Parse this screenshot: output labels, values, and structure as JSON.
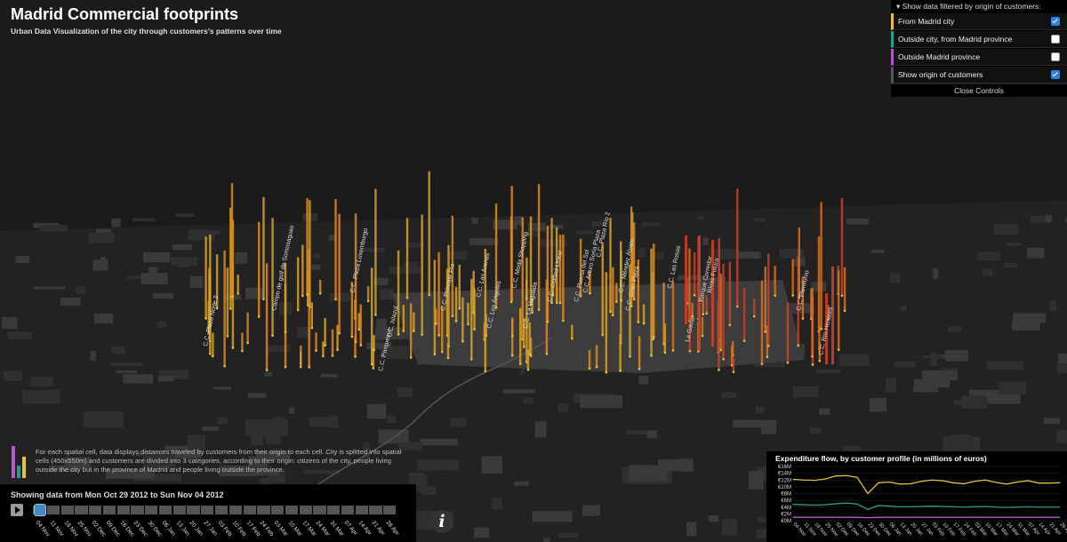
{
  "header": {
    "title": "Madrid Commercial footprints",
    "subtitle": "Urban Data Visualization of the city through customers's patterns over time"
  },
  "controls": {
    "heading": "Show data filtered by origin of customers:",
    "rows": [
      {
        "label": "From Madrid city",
        "checked": true,
        "color": "#e5c23a"
      },
      {
        "label": "Outside city, from Madrid province",
        "checked": false,
        "color": "#2a9a8d"
      },
      {
        "label": "Outside Madrid province",
        "checked": false,
        "color": "#b35bc4"
      },
      {
        "label": "Show origin of customers",
        "checked": true,
        "color": "#555555"
      }
    ],
    "close_label": "Close Controls"
  },
  "description": "For each spatial cell, data displays distances traveled by customers from their origin to each cell. City is splitted into spatial cells (450x550m) and customers are divided into 3 categories, according to their origin: citizens of the city, people living outside the city but in the province of Madrid and people living outside the province.",
  "timeline": {
    "showing": "Showing data from Mon Oct 29 2012 to Sun Nov 04 2012",
    "progress": 0.0,
    "weeks": [
      "04 Nov",
      "11 Nov",
      "18 Nov",
      "25 Nov",
      "02 Dec",
      "09 Dec",
      "16 Dec",
      "23 Dec",
      "30 Dec",
      "06 Jan",
      "13 Jan",
      "20 Jan",
      "27 Jan",
      "03 Feb",
      "10 Feb",
      "17 Feb",
      "24 Feb",
      "03 Mar",
      "10 Mar",
      "17 Mar",
      "24 Mar",
      "31 Mar",
      "07 Apr",
      "14 Apr",
      "21 Apr",
      "28 Apr"
    ]
  },
  "map_labels": [
    "C.C. Plaza Norte 2",
    "Campo de golf de Somosaguas",
    "C.C. Plaza Luxemburgo",
    "C.C. Parquesur",
    "C.C. Islazul",
    "C.C. Príncipe Pío",
    "C.C. Las Arenas",
    "C.C. Los Ángeles",
    "C.C. Moda Shopping",
    "C.C. La Vaguada",
    "C.C. Ciudad Lineal",
    "C.C. Puerta del Sol",
    "C.C. Arturo Soria Plaza",
    "C.C. Plaza Río 2",
    "C.C. Méndez Álvaro",
    "C.C. Gran Plaza",
    "C.C. Las Rosas",
    "La Gavia",
    "Parque Corredor",
    "Rivas Futura",
    "C.C. Plenilunio",
    "C.C. Río Henares"
  ],
  "chart_data": {
    "type": "line",
    "title": "Expenditure flow, by customer profile (in millions of euros)",
    "x": [
      "04 Nov",
      "11 Nov",
      "18 Nov",
      "25 Nov",
      "02 Dec",
      "09 Dec",
      "16 Dec",
      "23 Dec",
      "30 Dec",
      "06 Jan",
      "13 Jan",
      "20 Jan",
      "27 Jan",
      "03 Feb",
      "10 Feb",
      "17 Feb",
      "24 Feb",
      "03 Mar",
      "10 Mar",
      "17 Mar",
      "24 Mar",
      "31 Mar",
      "07 Apr",
      "14 Apr",
      "21 Apr",
      "28 Apr"
    ],
    "series": [
      {
        "color": "#e5c23a",
        "values": [
          12.2,
          12.0,
          11.9,
          12.3,
          13.2,
          13.3,
          12.8,
          8.0,
          11.2,
          11.4,
          10.8,
          10.9,
          11.6,
          12.0,
          11.8,
          11.2,
          10.9,
          11.6,
          12.0,
          11.3,
          10.8,
          11.4,
          11.8,
          11.1,
          11.1,
          11.2
        ]
      },
      {
        "color": "#2a9a8d",
        "values": [
          4.8,
          4.7,
          4.6,
          4.7,
          5.0,
          5.2,
          4.9,
          3.3,
          4.5,
          4.3,
          4.1,
          4.1,
          4.2,
          4.3,
          4.2,
          4.1,
          4.0,
          4.1,
          4.2,
          4.0,
          3.9,
          4.0,
          4.1,
          4.0,
          4.0,
          4.0
        ]
      },
      {
        "color": "#b35bc4",
        "values": [
          1.0,
          1.0,
          1.0,
          1.0,
          1.0,
          1.0,
          1.0,
          0.9,
          1.0,
          1.0,
          1.0,
          1.0,
          1.0,
          1.0,
          1.0,
          1.0,
          1.0,
          1.0,
          1.0,
          1.0,
          1.0,
          1.0,
          1.0,
          1.0,
          1.0,
          1.0
        ]
      }
    ],
    "yticks": [
      "€0M",
      "€2M",
      "€4M",
      "€6M",
      "€8M",
      "€10M",
      "€12M",
      "€14M",
      "€16M"
    ],
    "ylim": [
      0,
      16
    ]
  },
  "colors": {
    "accent": "#2a83e0",
    "madrid": "#e5c23a",
    "province": "#2a9a8d",
    "outside": "#b35bc4",
    "spikes": "#e07a1a"
  }
}
